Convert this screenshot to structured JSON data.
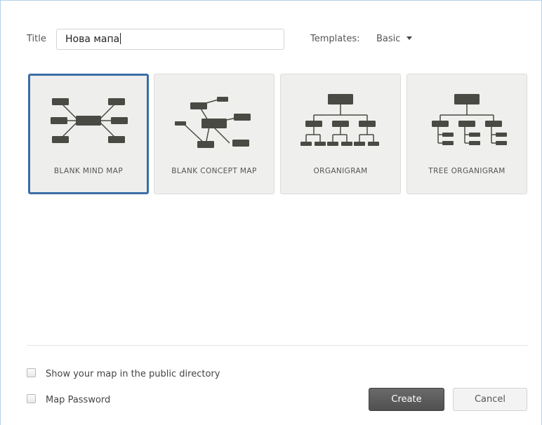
{
  "form": {
    "title_label": "Title",
    "title_value": "Нова мапа",
    "templates_label": "Templates:",
    "templates_selected": "Basic"
  },
  "templates": [
    {
      "label": "BLANK MIND MAP",
      "icon": "mind-map-icon",
      "selected": true
    },
    {
      "label": "BLANK CONCEPT MAP",
      "icon": "concept-map-icon",
      "selected": false
    },
    {
      "label": "ORGANIGRAM",
      "icon": "organigram-icon",
      "selected": false
    },
    {
      "label": "TREE ORGANIGRAM",
      "icon": "tree-organigram-icon",
      "selected": false
    }
  ],
  "options": {
    "public_directory_label": "Show your map in the public directory",
    "password_label": "Map Password"
  },
  "buttons": {
    "create": "Create",
    "cancel": "Cancel"
  },
  "colors": {
    "selected_border": "#3a6ea5",
    "node": "#4a4a44",
    "create_button": "#5a5a5a"
  }
}
